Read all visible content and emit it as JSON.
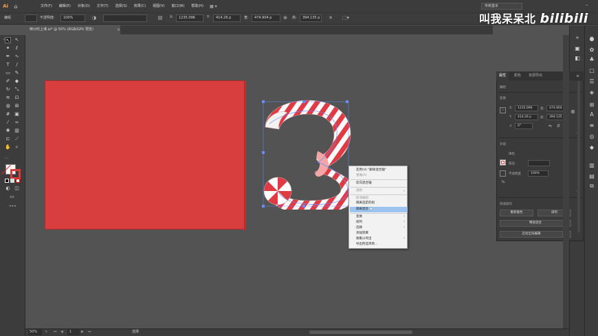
{
  "app": {
    "logo": "Ai"
  },
  "menu": [
    "文件(F)",
    "编辑(E)",
    "对象(O)",
    "文字(T)",
    "选择(S)",
    "效果(C)",
    "视图(V)",
    "窗口(W)",
    "帮助(H)"
  ],
  "workspace": "传统基本",
  "watermark": {
    "text": "叫我呆呆北",
    "logo": "bilibili"
  },
  "controlbar": {
    "selection_label": "编组",
    "opacity_label": "不透明度:",
    "opacity_value": "100%",
    "x_label": "X:",
    "x_value": "1235.096",
    "y_label": "Y:",
    "y_value": "414.26 p",
    "w_label": "宽:",
    "w_value": "474.904 p",
    "h_label": "高:",
    "h_value": "394.135 p"
  },
  "document": {
    "tab_title": "倒计时上课.ai* @ 50% (RGB/GPU 预览)",
    "close": "×"
  },
  "context_menu": {
    "items": [
      {
        "label": "还原(U) \"删除混合轴\"",
        "disabled": false,
        "submenu": false
      },
      {
        "label": "重做(R)",
        "disabled": true,
        "submenu": false
      },
      {
        "label": "反向混合轴",
        "disabled": false,
        "submenu": false
      },
      {
        "label": "透视",
        "disabled": true,
        "submenu": true
      },
      {
        "label": "取消编组",
        "disabled": true,
        "submenu": false
      },
      {
        "label": "隔离选定的组",
        "disabled": false,
        "submenu": false
      },
      {
        "label": "隔离混合",
        "disabled": false,
        "submenu": false,
        "highlight": true
      },
      {
        "label": "变换",
        "disabled": false,
        "submenu": true
      },
      {
        "label": "排列",
        "disabled": false,
        "submenu": true
      },
      {
        "label": "选择",
        "disabled": false,
        "submenu": true
      },
      {
        "label": "添加到库",
        "disabled": false,
        "submenu": false
      },
      {
        "label": "收集以导出",
        "disabled": false,
        "submenu": true
      },
      {
        "label": "导出所选项目...",
        "disabled": false,
        "submenu": false
      }
    ]
  },
  "properties": {
    "tabs": [
      "属性",
      "颜色",
      "资源导出"
    ],
    "section_group": "编组",
    "section_transform": "变换",
    "x_label": "X:",
    "x": "1235.096",
    "y_label": "Y:",
    "y": "414.26 p",
    "w_label": "宽:",
    "w": "474.904",
    "h_label": "高:",
    "h": "394.135",
    "angle_label": "∠",
    "angle": "0°",
    "section_appearance": "外观",
    "fill_label": "填色",
    "stroke_label": "描边",
    "opacity_label": "不透明度",
    "opacity": "100%",
    "fx": "fx.",
    "section_quick": "快速操作",
    "btn_recolor": "重新着色",
    "btn_arrange": "排列",
    "btn_release": "释放混合",
    "btn_global_edit": "启动全局编辑"
  },
  "statusbar": {
    "zoom": "50%",
    "artboard": "1",
    "tool": "选择"
  }
}
